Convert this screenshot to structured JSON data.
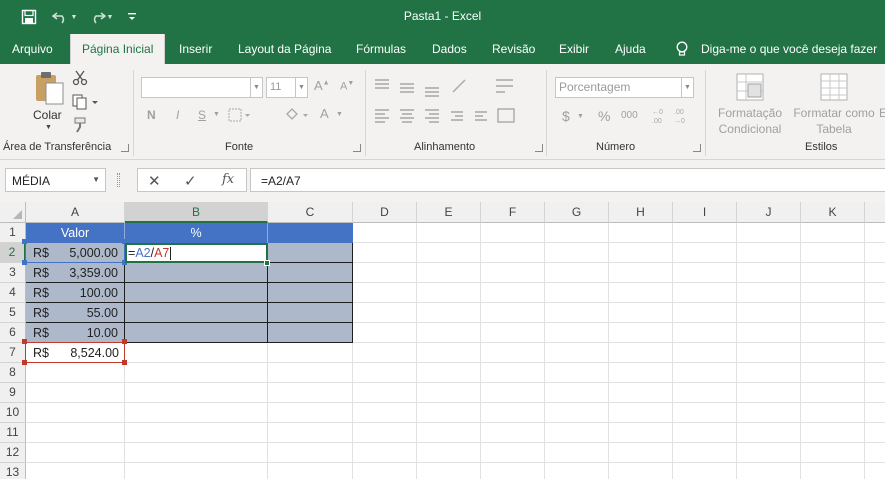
{
  "window": {
    "title": "Pasta1  -  Excel"
  },
  "quick_access": {
    "icons": [
      "save-icon",
      "undo-icon",
      "redo-icon",
      "customize-icon"
    ]
  },
  "tabs": [
    {
      "label": "Arquivo"
    },
    {
      "label": "Página Inicial"
    },
    {
      "label": "Inserir"
    },
    {
      "label": "Layout da Página"
    },
    {
      "label": "Fórmulas"
    },
    {
      "label": "Dados"
    },
    {
      "label": "Revisão"
    },
    {
      "label": "Exibir"
    },
    {
      "label": "Ajuda"
    }
  ],
  "tell_me": "Diga-me o que você deseja fazer",
  "ribbon": {
    "clipboard": {
      "label": "Área de Transferência",
      "paste": "Colar"
    },
    "font": {
      "label": "Fonte",
      "size": "11",
      "bold": "N",
      "italic": "I",
      "underline": "S"
    },
    "alignment": {
      "label": "Alinhamento"
    },
    "number": {
      "label": "Número",
      "format": "Porcentagem",
      "currency": "$",
      "percent": "%",
      "comma": "000"
    },
    "styles": {
      "label": "Estilos",
      "conditional": [
        "Formatação",
        "Condicional"
      ],
      "as_table": [
        "Formatar como",
        "Tabela"
      ],
      "cell_styles": "E"
    }
  },
  "formula_bar": {
    "name_box": "MÉDIA",
    "formula": "=A2/A7",
    "cancel": "✕",
    "enter": "✓",
    "fx": "fx"
  },
  "grid": {
    "columns": [
      "A",
      "B",
      "C",
      "D",
      "E",
      "F",
      "G",
      "H",
      "I",
      "J",
      "K"
    ],
    "rows": [
      "1",
      "2",
      "3",
      "4",
      "5",
      "6",
      "7",
      "8",
      "9",
      "10",
      "11",
      "12",
      "13"
    ],
    "header": {
      "A": "Valor",
      "B": "%"
    },
    "values": [
      {
        "currency": "R$",
        "amount": "5,000.00"
      },
      {
        "currency": "R$",
        "amount": "3,359.00"
      },
      {
        "currency": "R$",
        "amount": "100.00"
      },
      {
        "currency": "R$",
        "amount": "55.00"
      },
      {
        "currency": "R$",
        "amount": "10.00"
      },
      {
        "currency": "R$",
        "amount": "8,524.00"
      }
    ],
    "editing": {
      "eq": "=",
      "ref1": "A2",
      "op": "/",
      "ref2": "A7"
    }
  },
  "colors": {
    "excel_green": "#217346",
    "table_header": "#4472c4",
    "table_body": "#adb9ca",
    "ref1_color": "#4472c4",
    "ref2_color": "#c0392b"
  }
}
